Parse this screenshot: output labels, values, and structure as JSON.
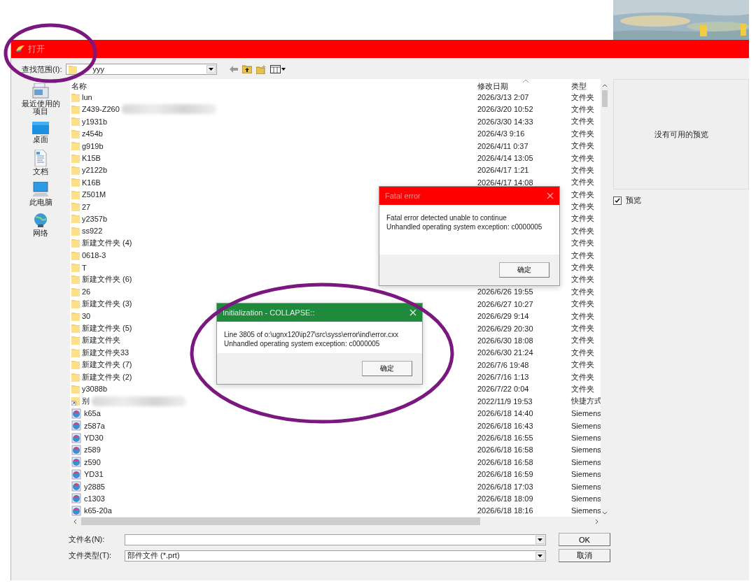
{
  "dialog": {
    "title": "打开",
    "look_in_label": "查找范围(I):",
    "look_in_value": "yyy",
    "places": [
      {
        "label": "最近使用的项目"
      },
      {
        "label": "桌面"
      },
      {
        "label": "文档"
      },
      {
        "label": "此电脑"
      },
      {
        "label": "网络"
      }
    ],
    "columns": [
      {
        "label": "名称",
        "sorted": false
      },
      {
        "label": "修改日期",
        "sorted": true
      },
      {
        "label": "类型",
        "sorted": false
      }
    ],
    "rows": [
      {
        "kind": "folder",
        "name": "lun",
        "date": "2026/3/13 2:07",
        "type": "文件夹",
        "redacted": false
      },
      {
        "kind": "folder",
        "name": "Z439-Z260",
        "date": "2026/3/20 10:52",
        "type": "文件夹",
        "redacted": true
      },
      {
        "kind": "folder",
        "name": "y1931b",
        "date": "2026/3/30 14:33",
        "type": "文件夹",
        "redacted": false
      },
      {
        "kind": "folder",
        "name": "z454b",
        "date": "2026/4/3 9:16",
        "type": "文件夹",
        "redacted": false
      },
      {
        "kind": "folder",
        "name": "g919b",
        "date": "2026/4/11 0:37",
        "type": "文件夹",
        "redacted": false
      },
      {
        "kind": "folder",
        "name": "K15B",
        "date": "2026/4/14 13:05",
        "type": "文件夹",
        "redacted": false
      },
      {
        "kind": "folder",
        "name": "y2122b",
        "date": "2026/4/17 1:21",
        "type": "文件夹",
        "redacted": false
      },
      {
        "kind": "folder",
        "name": "K16B",
        "date": "2026/4/17 14:08",
        "type": "文件夹",
        "redacted": false
      },
      {
        "kind": "folder",
        "name": "Z501M",
        "type": "文件夹",
        "redacted": false
      },
      {
        "kind": "folder",
        "name": "27",
        "type": "文件夹",
        "redacted": false
      },
      {
        "kind": "folder",
        "name": "y2357b",
        "type": "文件夹",
        "redacted": false
      },
      {
        "kind": "folder",
        "name": "ss922",
        "type": "文件夹",
        "redacted": false
      },
      {
        "kind": "folder",
        "name": "新建文件夹 (4)",
        "type": "文件夹",
        "redacted": false
      },
      {
        "kind": "folder",
        "name": "0618-3",
        "type": "文件夹",
        "redacted": false
      },
      {
        "kind": "folder",
        "name": "T",
        "type": "文件夹",
        "redacted": false
      },
      {
        "kind": "folder",
        "name": "新建文件夹 (6)",
        "type": "文件夹",
        "redacted": false
      },
      {
        "kind": "folder",
        "name": "26",
        "date": "2026/6/26 19:55",
        "type": "文件夹",
        "redacted": false
      },
      {
        "kind": "folder",
        "name": "新建文件夹 (3)",
        "date": "2026/6/27 10:27",
        "type": "文件夹",
        "redacted": false
      },
      {
        "kind": "folder",
        "name": "30",
        "date": "2026/6/29 9:14",
        "type": "文件夹",
        "redacted": false
      },
      {
        "kind": "folder",
        "name": "新建文件夹 (5)",
        "date": "2026/6/29 20:30",
        "type": "文件夹",
        "redacted": false
      },
      {
        "kind": "folder",
        "name": "新建文件夹",
        "date": "2026/6/30 18:08",
        "type": "文件夹",
        "redacted": false
      },
      {
        "kind": "folder",
        "name": "新建文件夹33",
        "date": "2026/6/30 21:24",
        "type": "文件夹",
        "redacted": false
      },
      {
        "kind": "folder",
        "name": "新建文件夹 (7)",
        "date": "2026/7/6 19:48",
        "type": "文件夹",
        "redacted": false
      },
      {
        "kind": "folder",
        "name": "新建文件夹 (2)",
        "date": "2026/7/16 1:13",
        "type": "文件夹",
        "redacted": false
      },
      {
        "kind": "folder",
        "name": "y3088b",
        "date": "2026/7/22 0:04",
        "type": "文件夹",
        "redacted": false
      },
      {
        "kind": "shortcut",
        "name": "别",
        "date": "2022/11/9 19:53",
        "type": "快捷方式",
        "redacted": true
      },
      {
        "kind": "part",
        "name": "k65a",
        "date": "2026/6/18 14:40",
        "type": "Siemens",
        "redacted": false
      },
      {
        "kind": "part",
        "name": "z587a",
        "date": "2026/6/18 16:43",
        "type": "Siemens",
        "redacted": false
      },
      {
        "kind": "part",
        "name": "YD30",
        "date": "2026/6/18 16:55",
        "type": "Siemens",
        "redacted": false
      },
      {
        "kind": "part",
        "name": "z589",
        "date": "2026/6/18 16:58",
        "type": "Siemens",
        "redacted": false
      },
      {
        "kind": "part",
        "name": "z590",
        "date": "2026/6/18 16:58",
        "type": "Siemens",
        "redacted": false
      },
      {
        "kind": "part",
        "name": "YD31",
        "date": "2026/6/18 16:59",
        "type": "Siemens",
        "redacted": false
      },
      {
        "kind": "part",
        "name": "y2885",
        "date": "2026/6/18 17:03",
        "type": "Siemens",
        "redacted": false
      },
      {
        "kind": "part",
        "name": "c1303",
        "date": "2026/6/18 18:09",
        "type": "Siemens",
        "redacted": false
      },
      {
        "kind": "part",
        "name": "k65-20a",
        "date": "2026/6/18 18:16",
        "type": "Siemens",
        "redacted": false
      }
    ],
    "preview": {
      "text": "没有可用的预览",
      "checkbox_label": "预览",
      "checked": true
    },
    "file_name": {
      "label": "文件名(N):"
    },
    "file_type": {
      "label": "文件类型(T):",
      "value": "部件文件 (*.prt)"
    },
    "buttons": [
      {
        "label": "OK"
      },
      {
        "label": "取消"
      }
    ]
  },
  "error_dialogs": [
    {
      "title": "Fatal error",
      "color": "#ff0000",
      "lines": [
        "Fatal error detected unable to continue",
        "Unhandled operating system exception: c0000005"
      ],
      "button": "确定"
    },
    {
      "title": "Initialization - COLLAPSE::",
      "color": "#1f8a3c",
      "lines": [
        "Line 3805 of o:\\ugnx120\\ip27\\src\\syss\\error\\ind\\error.cxx",
        "Unhandled operating system exception: c0000005"
      ],
      "button": "确定"
    }
  ]
}
